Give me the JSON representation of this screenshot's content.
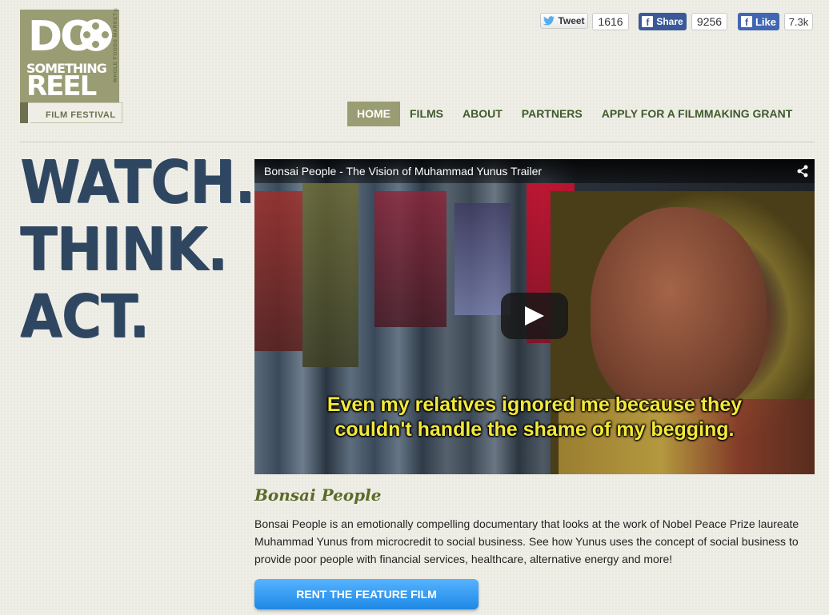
{
  "logo": {
    "do": "DO",
    "something": "SOMETHING",
    "reel": "REEL",
    "festival": "FILM FESTIVAL",
    "sponsor": "WHOLE FOODS MARKET®"
  },
  "social": {
    "tweet_label": "Tweet",
    "tweet_count": "1616",
    "share_label": "Share",
    "share_count": "9256",
    "like_label": "Like",
    "like_count": "7.3k"
  },
  "nav": {
    "items": [
      "HOME",
      "FILMS",
      "ABOUT",
      "PARTNERS",
      "APPLY FOR A FILMMAKING GRANT"
    ],
    "active": "HOME"
  },
  "slogan": [
    "WATCH.",
    "THINK.",
    "ACT."
  ],
  "video": {
    "title": "Bonsai People - The Vision of Muhammad Yunus Trailer",
    "subtitle_line1": "Even my relatives ignored me because they",
    "subtitle_line2": "couldn't handle the shame of my begging."
  },
  "film": {
    "title": "Bonsai People",
    "description": "Bonsai People is an emotionally compelling documentary that looks at the work of Nobel Peace Prize laureate Muhammad Yunus from microcredit to social business. See how Yunus uses the concept of social business to provide poor people with financial services, healthcare, alternative energy and more!",
    "cta": "RENT THE FEATURE FILM"
  },
  "colors": {
    "brand_olive": "#9a9c73",
    "nav_green": "#3f5a2c",
    "slogan_blue": "#2f4660",
    "cta_blue": "#1e88e5"
  }
}
